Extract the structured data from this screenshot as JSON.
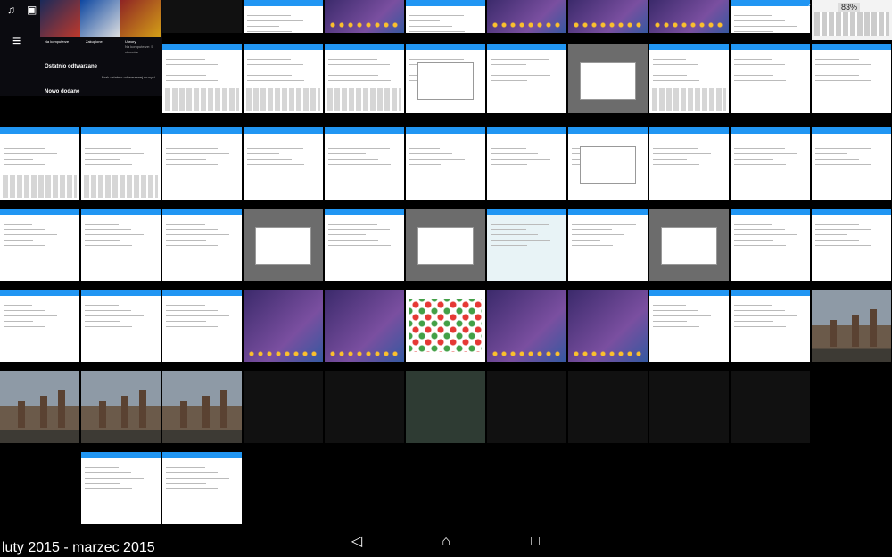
{
  "screen": {
    "status_battery": "83%",
    "date_range_label": "luty 2015 - marzec 2015"
  },
  "music_app": {
    "categories": [
      {
        "title": "Na komputerze",
        "sub": ""
      },
      {
        "title": "Zakupione",
        "sub": ""
      },
      {
        "title": "Utwory",
        "sub": "Na komputerze: 5 utworów"
      }
    ],
    "section_recent": "Ostatnio odtwarzane",
    "empty_message": "Brak ostatnio odtwarzanej muzyki",
    "section_new": "Nowo dodane"
  },
  "icons": {
    "music_note": "music-note-icon",
    "image": "image-icon",
    "menu": "hamburger-menu-icon",
    "wifi": "wifi-icon",
    "back": "back-icon",
    "home": "home-icon",
    "recents": "recents-icon"
  },
  "colors": {
    "accent_blue": "#2196f3",
    "background": "#000000"
  },
  "navbar": {
    "back_glyph": "◁",
    "home_glyph": "⌂",
    "recents_glyph": "□"
  }
}
